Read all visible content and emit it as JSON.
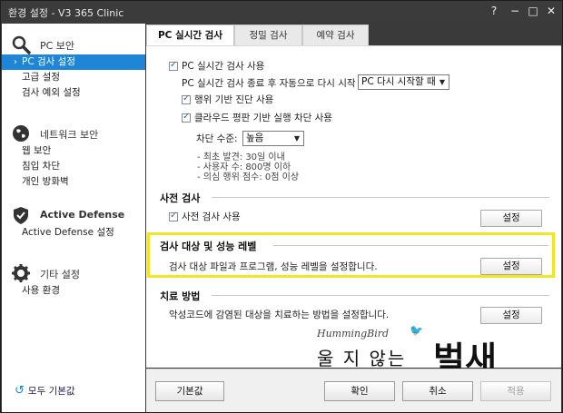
{
  "window": {
    "title": "환경 설정 - V3 365 Clinic",
    "help": "?",
    "minimize": "−",
    "maximize": "□",
    "close": "✕"
  },
  "sidebar": {
    "groups": [
      {
        "icon": "magnifier-icon",
        "label": "PC 보안",
        "items": [
          "PC 검사 설정",
          "고급 설정",
          "검사 예외 설정"
        ]
      },
      {
        "icon": "globe-icon",
        "label": "네트워크 보안",
        "items": [
          "웹 보안",
          "침입 차단",
          "개인 방화벽"
        ]
      },
      {
        "icon": "shield-check-icon",
        "label": "Active Defense",
        "items": [
          "Active Defense 설정"
        ]
      },
      {
        "icon": "gear-icon",
        "label": "기타 설정",
        "items": [
          "사용 환경"
        ]
      }
    ],
    "active_item": "PC 검사 설정",
    "restore_defaults": "모두 기본값"
  },
  "tabs": [
    "PC 실시간 검사",
    "정밀 검사",
    "예약 검사"
  ],
  "realtime": {
    "enable_label": "PC 실시간 검사 사용",
    "restart_label": "PC 실시간 검사 종료 후 자동으로 다시 시작",
    "restart_value": "PC 다시 시작할 때",
    "behavior_label": "행위 기반 진단 사용",
    "cloud_label": "클라우드 평판 기반 실행 차단 사용",
    "block_level_label": "차단 수준:",
    "block_level_value": "높음",
    "criteria": [
      "- 최초 발견: 30일 이내",
      "- 사용자 수: 800명 이하",
      "- 의심 행위 점수: 0점 이상"
    ]
  },
  "pre_scan": {
    "title": "사전 검사",
    "enable_label": "사전 검사 사용",
    "button": "설정"
  },
  "scan_target": {
    "title": "검사 대상 및 성능 레벨",
    "description": "검사 대상 파일과 프로그램, 성능 레벨을 설정합니다.",
    "button": "설정"
  },
  "treatment": {
    "title": "치료 방법",
    "description": "악성코드에 감염된 대상을 치료하는 방법을 설정합니다.",
    "button": "설정"
  },
  "watermark": {
    "brand": "HummingBird",
    "slogan_small": "울 지 않는",
    "slogan_big": "벌새"
  },
  "footer": {
    "default_button": "기본값",
    "ok_button": "확인",
    "cancel_button": "취소",
    "apply_button": "적용"
  },
  "colors": {
    "accent": "#1f85d6",
    "highlight": "#f0e626",
    "titlebar": "#3b3b3b"
  }
}
